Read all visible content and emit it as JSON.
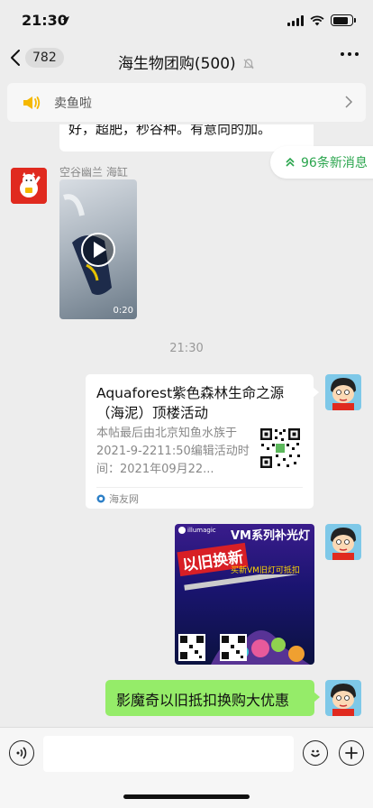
{
  "status_bar": {
    "time": "21:30"
  },
  "nav": {
    "unread_count": "782",
    "title": "海生物团购(500)"
  },
  "announcement": {
    "text": "卖鱼啦"
  },
  "messages": {
    "partial_text": "好，超肥，秒谷种。有意向的加。",
    "new_messages": "96条新消息",
    "sender_name": "空谷幽兰 海缸",
    "video_duration": "0:20",
    "timestamp": "21:30",
    "link_card": {
      "title": "Aquaforest紫色森林生命之源（海泥）顶楼活动",
      "description": "本帖最后由北京知鱼水族于2021-9-2211:50编辑活动时间：2021年09月22...",
      "source": "海友网"
    },
    "poster": {
      "brand": "illumagic",
      "headline": "VM系列补光灯",
      "badge": "以旧换新",
      "subline": "买新VM旧灯可抵扣"
    },
    "text_bubble": "影魔奇以旧抵扣换购大优惠"
  },
  "colors": {
    "bubble_green": "#95ec69",
    "accent_green": "#2aa54d",
    "announce_yellow": "#f5b800"
  }
}
